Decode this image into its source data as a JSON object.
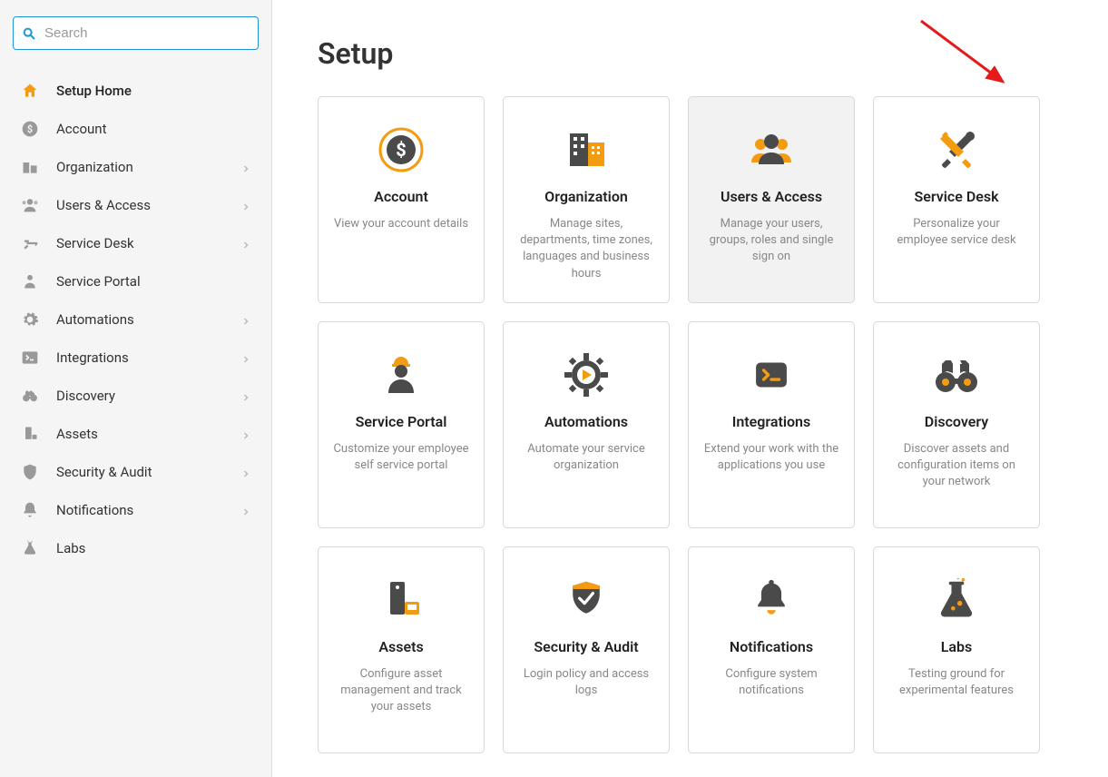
{
  "search": {
    "placeholder": "Search"
  },
  "sidebar": {
    "items": [
      {
        "label": "Setup Home",
        "chevron": false,
        "active": true
      },
      {
        "label": "Account",
        "chevron": false
      },
      {
        "label": "Organization",
        "chevron": true
      },
      {
        "label": "Users & Access",
        "chevron": true
      },
      {
        "label": "Service Desk",
        "chevron": true
      },
      {
        "label": "Service Portal",
        "chevron": false
      },
      {
        "label": "Automations",
        "chevron": true
      },
      {
        "label": "Integrations",
        "chevron": true
      },
      {
        "label": "Discovery",
        "chevron": true
      },
      {
        "label": "Assets",
        "chevron": true
      },
      {
        "label": "Security & Audit",
        "chevron": true
      },
      {
        "label": "Notifications",
        "chevron": true
      },
      {
        "label": "Labs",
        "chevron": false
      }
    ]
  },
  "main": {
    "title": "Setup",
    "cards": [
      {
        "title": "Account",
        "desc": "View your account details"
      },
      {
        "title": "Organization",
        "desc": "Manage sites, departments, time zones, languages and business hours"
      },
      {
        "title": "Users & Access",
        "desc": "Manage your users, groups, roles and single sign on",
        "highlight": true
      },
      {
        "title": "Service Desk",
        "desc": "Personalize your employee service desk"
      },
      {
        "title": "Service Portal",
        "desc": "Customize your employee self service portal"
      },
      {
        "title": "Automations",
        "desc": "Automate your service organization"
      },
      {
        "title": "Integrations",
        "desc": "Extend your work with the applications you use"
      },
      {
        "title": "Discovery",
        "desc": "Discover assets and configuration items on your network"
      },
      {
        "title": "Assets",
        "desc": "Configure asset management and track your assets"
      },
      {
        "title": "Security & Audit",
        "desc": "Login policy and access logs"
      },
      {
        "title": "Notifications",
        "desc": "Configure system notifications"
      },
      {
        "title": "Labs",
        "desc": "Testing ground for experimental features"
      }
    ]
  }
}
